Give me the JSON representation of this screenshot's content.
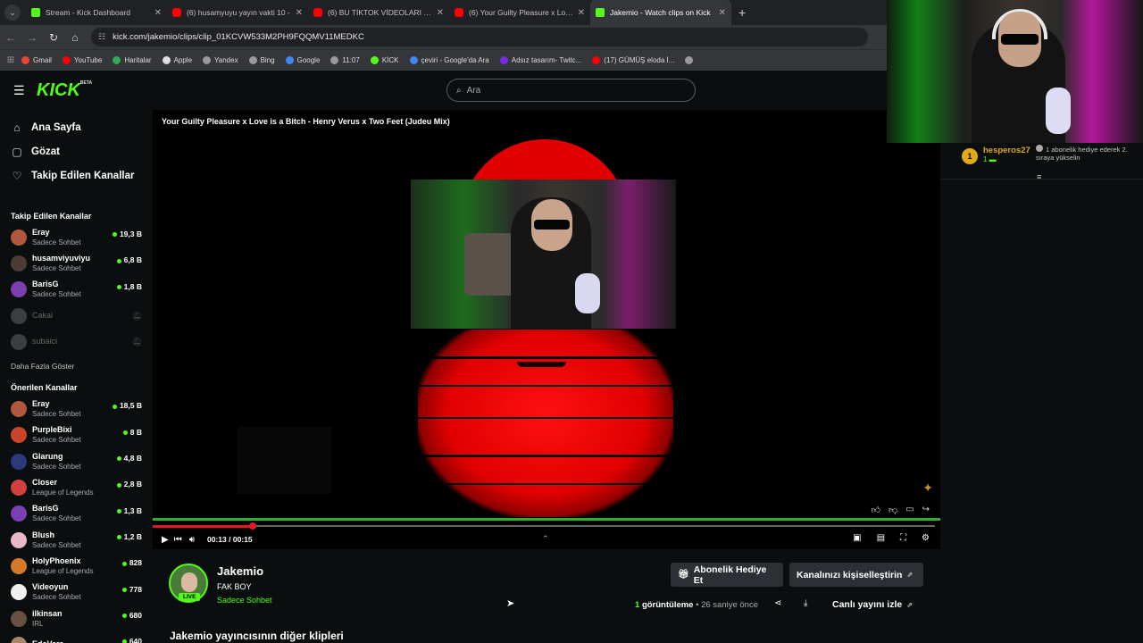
{
  "browser": {
    "tabs": [
      {
        "title": "Stream - Kick Dashboard",
        "icon": "kick",
        "active": false
      },
      {
        "title": "(6) husamyuyu yayın vakti 10 -",
        "icon": "youtube",
        "active": false
      },
      {
        "title": "(6) BU TİKTOK VİDEOLARI GER",
        "icon": "youtube",
        "active": false
      },
      {
        "title": "(6) Your Guilty Pleasure x Love i",
        "icon": "youtube",
        "active": false
      },
      {
        "title": "Jakemio - Watch clips on Kick",
        "icon": "kick",
        "active": true
      }
    ],
    "url": "kick.com/jakemio/clips/clip_01KCVW533M2PH9FQQMV11MEDKC",
    "bookmarks": [
      "Gmail",
      "YouTube",
      "Haritalar",
      "Apple",
      "Yandex",
      "Bing",
      "Google",
      "11:07",
      "KİCK",
      "çeviri - Google'da Ara",
      "Adsız tasarım- Twitc...",
      "(17) GÜMÜŞ eloda İ..."
    ]
  },
  "header": {
    "logo_text": "KICK",
    "logo_badge": "BETA",
    "search_placeholder": "Ara"
  },
  "sidebar": {
    "nav": [
      {
        "label": "Ana Sayfa",
        "icon": "home-icon"
      },
      {
        "label": "Gözat",
        "icon": "browse-icon"
      },
      {
        "label": "Takip Edilen Kanallar",
        "icon": "heart-icon"
      }
    ],
    "following_title": "Takip Edilen Kanallar",
    "following": [
      {
        "name": "Eray",
        "category": "Sadece Sohbet",
        "viewers": "19,3 B",
        "live": true,
        "color": "#b2563f"
      },
      {
        "name": "husamviyuviyu",
        "category": "Sadece Sohbet",
        "viewers": "6,8 B",
        "live": true,
        "color": "#4d3b35"
      },
      {
        "name": "BarisG",
        "category": "Sadece Sohbet",
        "viewers": "1,8 B",
        "live": true,
        "color": "#7a3fb0"
      },
      {
        "name": "Cakal",
        "category": "",
        "viewers": "",
        "live": false,
        "color": "#777"
      },
      {
        "name": "subaici",
        "category": "",
        "viewers": "",
        "live": false,
        "color": "#777"
      }
    ],
    "show_more": "Daha Fazla Göster",
    "recommended_title": "Önerilen Kanallar",
    "recommended": [
      {
        "name": "Eray",
        "category": "Sadece Sohbet",
        "viewers": "18,5 B",
        "color": "#b2563f"
      },
      {
        "name": "PurpleBixi",
        "category": "Sadece Sohbet",
        "viewers": "8 B",
        "color": "#c9442a"
      },
      {
        "name": "Glarung",
        "category": "Sadece Sohbet",
        "viewers": "4,8 B",
        "color": "#2a3a7a"
      },
      {
        "name": "Closer",
        "category": "League of Legends",
        "viewers": "2,8 B",
        "color": "#d04040"
      },
      {
        "name": "BarisG",
        "category": "Sadece Sohbet",
        "viewers": "1,3 B",
        "color": "#7a3fb0"
      },
      {
        "name": "Blush",
        "category": "Sadece Sohbet",
        "viewers": "1,2 B",
        "color": "#e8b7c8"
      },
      {
        "name": "HolyPhoenix",
        "category": "League of Legends",
        "viewers": "828",
        "color": "#d27a2a"
      },
      {
        "name": "Videoyun",
        "category": "Sadece Sohbet",
        "viewers": "778",
        "color": "#f0f0f0"
      },
      {
        "name": "ilkinsan",
        "category": "IRL",
        "viewers": "680",
        "color": "#6a5040"
      },
      {
        "name": "EdaVera",
        "category": "",
        "viewers": "640",
        "color": "#aa8866"
      }
    ]
  },
  "player": {
    "clip_title": "Your Guilty Pleasure x Love is a Bitch - Henry Verus x Two Feet (Judeu Mix)",
    "time_current": "00:13",
    "time_separator": "/",
    "time_total": "00:15",
    "progress": 0.128
  },
  "channel": {
    "name": "Jakemio",
    "stream_title": "FAK BOY",
    "category": "Sadece Sohbet",
    "live_label": "LIVE",
    "gift_sub_label": "Abonelik Hediye Et",
    "customize_label": "Kanalınızı kişiselleştirin",
    "views_count": "1",
    "views_label": "görüntüleme",
    "meta_sep": "•",
    "time_ago": "26 saniye önce",
    "watch_live_label": "Canlı yayını izle",
    "other_clips_title": "Jakemio yayıncısının diğer klipleri"
  },
  "chat": {
    "gift_rank": "1",
    "gift_user": "hesperos27",
    "gift_count": "1",
    "gift_message": "1 abonelik hediye ederek 2. sıraya yükselin"
  },
  "colors": {
    "kick_green": "#53fc18",
    "background": "#0b0e0f",
    "sun_red": "#e00000"
  }
}
